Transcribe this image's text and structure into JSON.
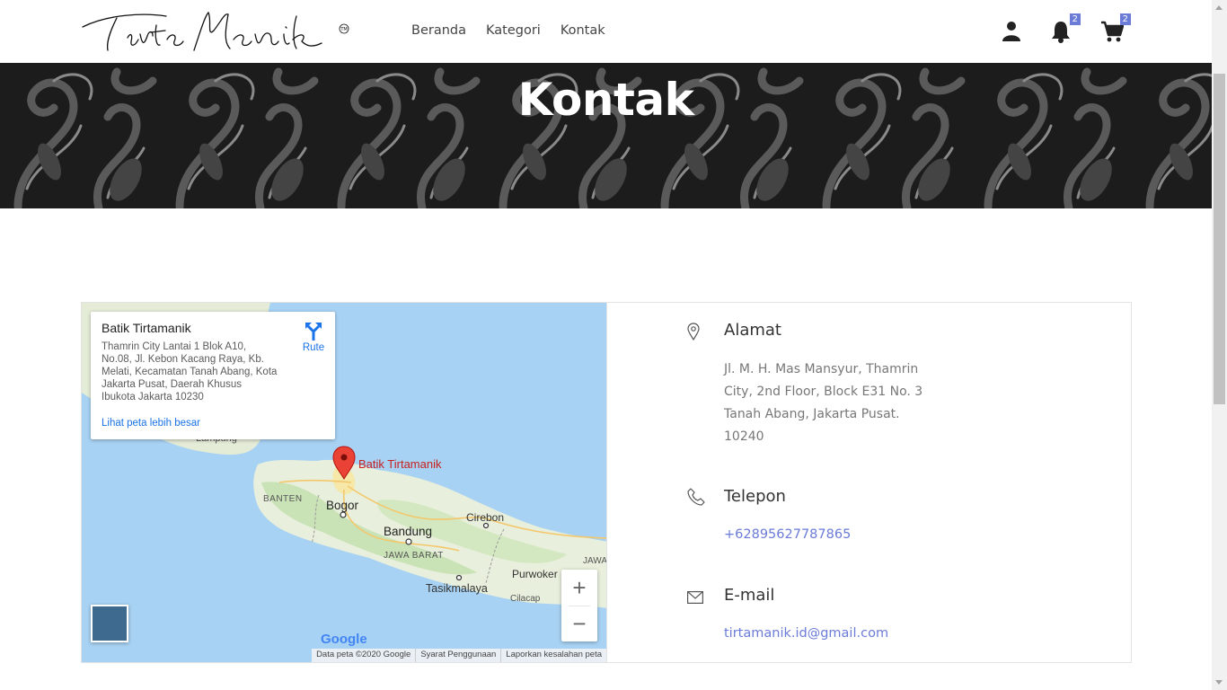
{
  "header": {
    "logo_text": "Tirta Manik",
    "logo_mark": "TM",
    "nav": [
      {
        "label": "Beranda"
      },
      {
        "label": "Kategori"
      },
      {
        "label": "Kontak"
      }
    ],
    "icons": {
      "user": "user-icon",
      "notifications": "bell-icon",
      "cart": "cart-icon"
    },
    "notification_count": "2",
    "cart_count": "2"
  },
  "hero": {
    "title": "Kontak"
  },
  "map": {
    "place_name": "Batik Tirtamanik",
    "place_address": "Thamrin City Lantai 1 Blok A10, No.08, Jl. Kebon Kacang Raya, Kb. Melati, Kecamatan Tanah Abang, Kota Jakarta Pusat, Daerah Khusus Ibukota Jakarta 10230",
    "larger_map_link": "Lihat peta lebih besar",
    "route_label": "Rute",
    "pin_label": "Batik Tirtamanik",
    "labels": {
      "banten": "BANTEN",
      "bogor": "Bogor",
      "bandung": "Bandung",
      "cirebon": "Cirebon",
      "jawa_barat": "JAWA BARAT",
      "tasikmalaya": "Tasikmalaya",
      "purwokerto": "Purwoker",
      "cilacap": "Cilacap",
      "jawa": "JAWA",
      "lampung": "Lampung"
    },
    "zoom_in": "+",
    "zoom_out": "−",
    "google": "Google",
    "attribution": [
      "Data peta ©2020 Google",
      "Syarat Penggunaan",
      "Laporkan kesalahan peta"
    ]
  },
  "contact": {
    "address_heading": "Alamat",
    "address_lines": [
      "Jl. M. H. Mas Mansyur, Thamrin",
      "City, 2nd Floor, Block E31 No. 3",
      "Tanah Abang, Jakarta Pusat.",
      "10240"
    ],
    "phone_heading": "Telepon",
    "phone": "+62895627787865",
    "email_heading": "E-mail",
    "email": "tirtamanik.id@gmail.com"
  },
  "colors": {
    "accent": "#6b7bd8",
    "map_water": "#a8d2f3",
    "map_land": "#e8efdc",
    "pin": "#ea4335"
  }
}
